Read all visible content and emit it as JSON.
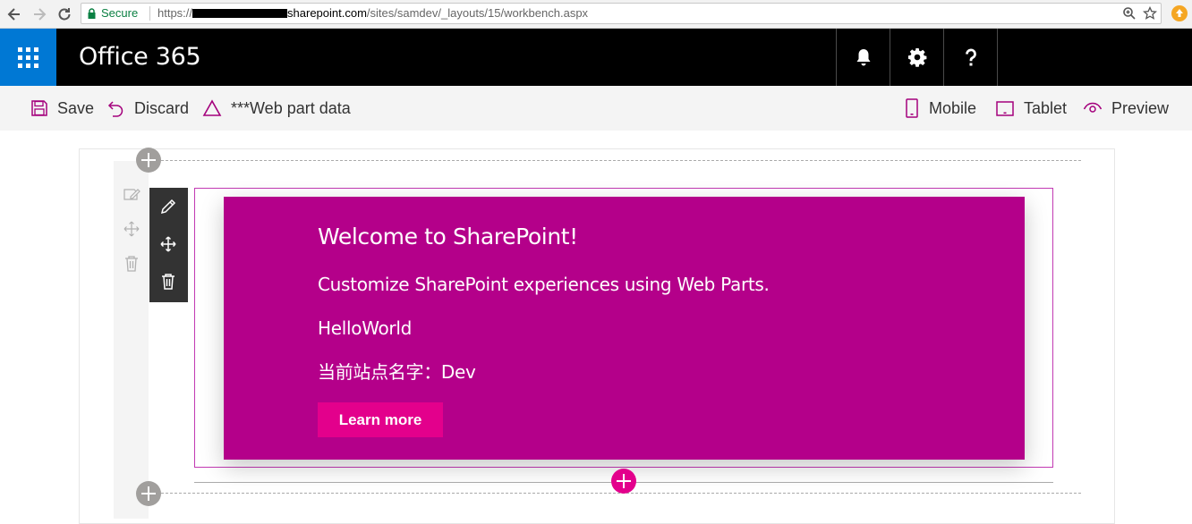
{
  "browser": {
    "secure_label": "Secure",
    "url_scheme": "https://",
    "url_host": "sharepoint.com",
    "url_path": "/sites/samdev/_layouts/15/workbench.aspx"
  },
  "suite": {
    "title": "Office 365",
    "buttons": [
      "bell-icon",
      "gear-icon",
      "help-icon"
    ]
  },
  "commands": {
    "save": "Save",
    "discard": "Discard",
    "webpart_data": "***Web part data",
    "mobile": "Mobile",
    "tablet": "Tablet",
    "preview": "Preview"
  },
  "webpart": {
    "title": "Welcome to SharePoint!",
    "subtitle": "Customize SharePoint experiences using Web Parts.",
    "description": "HelloWorld",
    "site_name": "当前站点名字：Dev",
    "button": "Learn more"
  },
  "colors": {
    "suite_bg": "#000000",
    "waffle_bg": "#0078d4",
    "accent": "#b4008a",
    "button_pink": "#e3008c",
    "command_icon": "#a4007c"
  }
}
